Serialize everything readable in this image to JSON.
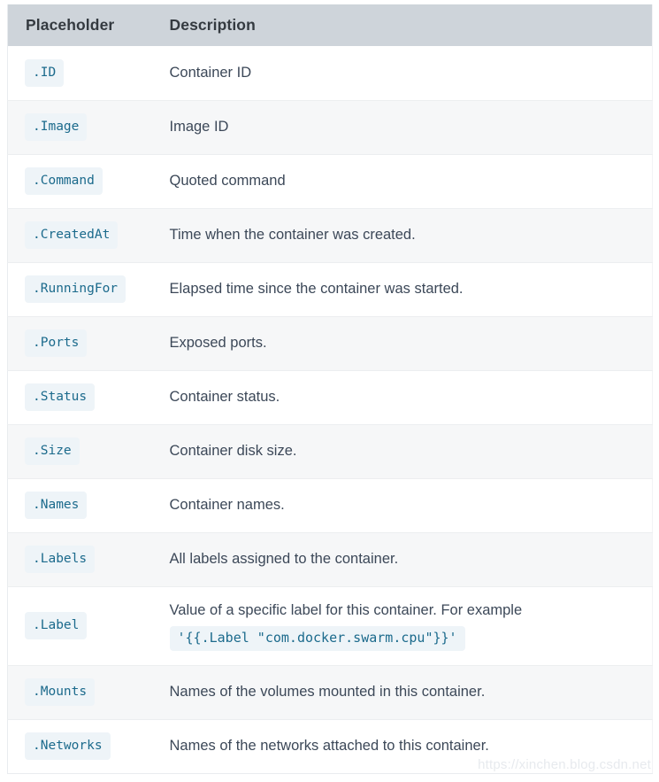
{
  "table": {
    "columns": [
      "Placeholder",
      "Description"
    ],
    "rows": [
      {
        "placeholder": ".ID",
        "description": "Container ID"
      },
      {
        "placeholder": ".Image",
        "description": "Image ID"
      },
      {
        "placeholder": ".Command",
        "description": "Quoted command"
      },
      {
        "placeholder": ".CreatedAt",
        "description": "Time when the container was created."
      },
      {
        "placeholder": ".RunningFor",
        "description": "Elapsed time since the container was started."
      },
      {
        "placeholder": ".Ports",
        "description": "Exposed ports."
      },
      {
        "placeholder": ".Status",
        "description": "Container status."
      },
      {
        "placeholder": ".Size",
        "description": "Container disk size."
      },
      {
        "placeholder": ".Names",
        "description": "Container names."
      },
      {
        "placeholder": ".Labels",
        "description": "All labels assigned to the container."
      },
      {
        "placeholder": ".Label",
        "description": "Value of a specific label for this container. For example",
        "description_code": "'{{.Label \"com.docker.swarm.cpu\"}}'"
      },
      {
        "placeholder": ".Mounts",
        "description": "Names of the volumes mounted in this container."
      },
      {
        "placeholder": ".Networks",
        "description": "Names of the networks attached to this container."
      }
    ]
  },
  "watermark": "https://xinchen.blog.csdn.net",
  "colors": {
    "header_bg": "#ced4da",
    "row_alt_bg": "#f6f7f8",
    "code_bg": "#eef4f8",
    "code_fg": "#1b6a8c",
    "text": "#3c4858"
  }
}
